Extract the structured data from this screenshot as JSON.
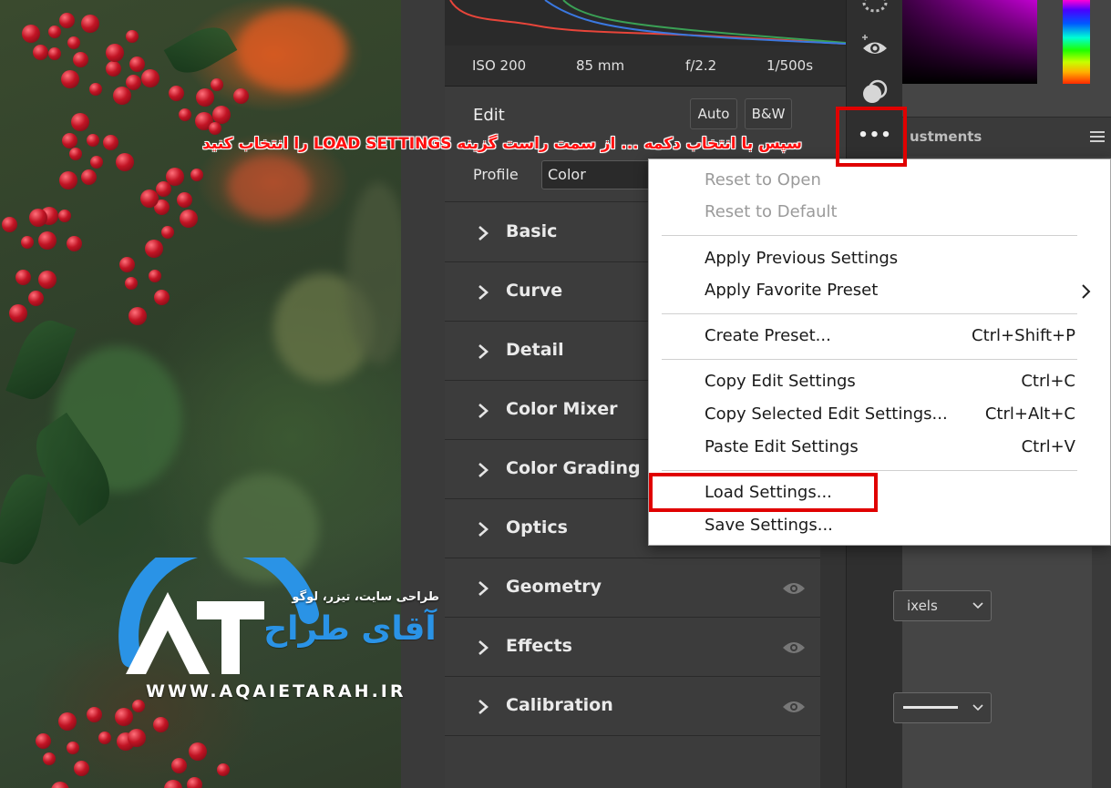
{
  "exif": {
    "iso": "ISO 200",
    "focal": "85 mm",
    "aperture": "f/2.2",
    "shutter": "1/500s"
  },
  "edit": {
    "title": "Edit",
    "auto_label": "Auto",
    "bw_label": "B&W",
    "profile_label": "Profile",
    "profile_value": "Color"
  },
  "sections": [
    {
      "label": "Basic",
      "eye": false
    },
    {
      "label": "Curve",
      "eye": false
    },
    {
      "label": "Detail",
      "eye": false
    },
    {
      "label": "Color Mixer",
      "eye": false
    },
    {
      "label": "Color Grading",
      "eye": false
    },
    {
      "label": "Optics",
      "eye": false
    },
    {
      "label": "Geometry",
      "eye": true
    },
    {
      "label": "Effects",
      "eye": true
    },
    {
      "label": "Calibration",
      "eye": true
    }
  ],
  "toolbar": {
    "icons": [
      "heal-icon",
      "redeye-icon",
      "mask-icon",
      "more-options-icon"
    ],
    "more_label": "•••"
  },
  "right_panel": {
    "adjustments_tab": "ustments",
    "units_select": "ixels",
    "style_select": ""
  },
  "menu": {
    "reset_open": "Reset to Open",
    "reset_default": "Reset to Default",
    "apply_previous": "Apply Previous Settings",
    "apply_favorite": "Apply Favorite Preset",
    "create_preset": "Create Preset...",
    "create_preset_sc": "Ctrl+Shift+P",
    "copy_edit": "Copy Edit Settings",
    "copy_edit_sc": "Ctrl+C",
    "copy_selected": "Copy Selected Edit Settings...",
    "copy_selected_sc": "Ctrl+Alt+C",
    "paste_edit": "Paste Edit Settings",
    "paste_edit_sc": "Ctrl+V",
    "load_settings": "Load Settings...",
    "save_settings": "Save Settings..."
  },
  "annotation": {
    "instruction": "سپس با انتخاب دکمه ... از سمت راست گزینه LOAD SETTINGS را انتخاب کنید",
    "highlight_color": "#e00000"
  },
  "watermark": {
    "tagline": "طراحی سایت، تیزر، لوگو",
    "brand": "آقای طراح",
    "url": "WWW.AQAIETARAH.IR",
    "brand_color": "#2a93e6"
  },
  "colors": {
    "panel_bg": "#3c3c3c",
    "menu_bg": "#ffffff"
  }
}
